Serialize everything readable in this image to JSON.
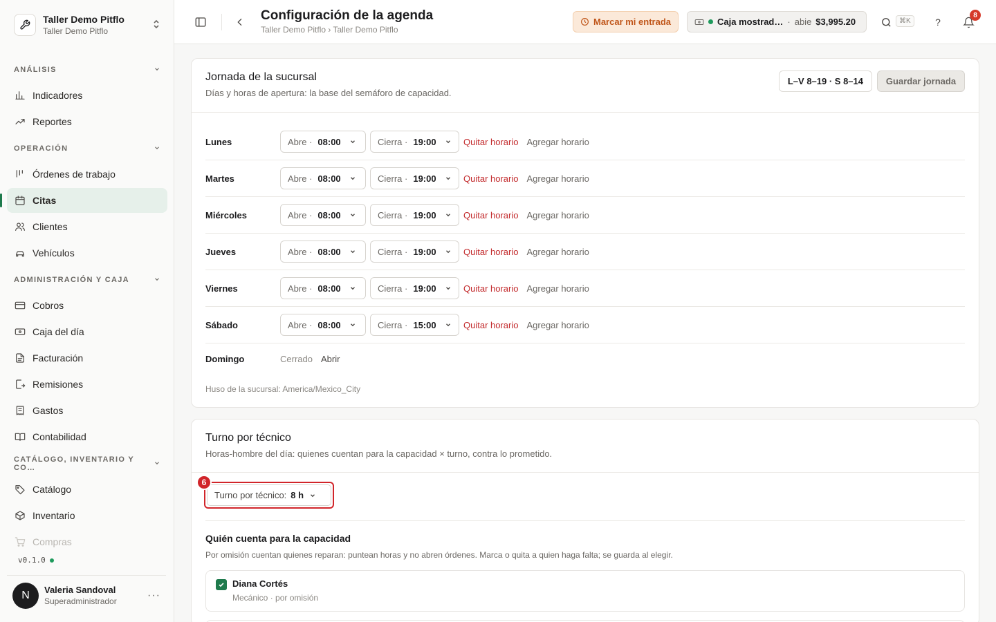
{
  "org": {
    "name": "Taller Demo Pitflo",
    "subtitle": "Taller Demo Pitflo"
  },
  "nav": {
    "sections": [
      {
        "label": "ANÁLISIS",
        "items": [
          {
            "label": "Indicadores",
            "icon": "bar-chart-icon"
          },
          {
            "label": "Reportes",
            "icon": "trend-up-icon"
          }
        ]
      },
      {
        "label": "OPERACIÓN",
        "items": [
          {
            "label": "Órdenes de trabajo",
            "icon": "kanban-icon"
          },
          {
            "label": "Citas",
            "icon": "calendar-icon",
            "active": true
          },
          {
            "label": "Clientes",
            "icon": "users-icon"
          },
          {
            "label": "Vehículos",
            "icon": "car-icon"
          }
        ]
      },
      {
        "label": "ADMINISTRACIÓN Y CAJA",
        "items": [
          {
            "label": "Cobros",
            "icon": "credit-card-icon"
          },
          {
            "label": "Caja del día",
            "icon": "banknote-icon"
          },
          {
            "label": "Facturación",
            "icon": "file-text-icon"
          },
          {
            "label": "Remisiones",
            "icon": "file-export-icon"
          },
          {
            "label": "Gastos",
            "icon": "receipt-icon"
          },
          {
            "label": "Contabilidad",
            "icon": "book-icon"
          }
        ]
      },
      {
        "label": "CATÁLOGO, INVENTARIO Y CO…",
        "items": [
          {
            "label": "Catálogo",
            "icon": "tag-icon"
          },
          {
            "label": "Inventario",
            "icon": "box-icon"
          },
          {
            "label": "Compras",
            "icon": "cart-icon",
            "faded": true
          }
        ]
      }
    ]
  },
  "version": "v0.1.0",
  "user": {
    "initial": "N",
    "name": "Valeria Sandoval",
    "role": "Superadministrador"
  },
  "header": {
    "title": "Configuración de la agenda",
    "breadcrumb": "Taller Demo Pitflo › Taller Demo Pitflo",
    "clock_in": "Marcar mi entrada",
    "caja_name": "Caja mostrad…",
    "caja_sep": "·",
    "caja_state": "abie",
    "caja_amount": "$3,995.20",
    "search_kbd": "⌘K",
    "help": "?",
    "notifications": "8"
  },
  "hours": {
    "title": "Jornada de la sucursal",
    "description": "Días y horas de apertura: la base del semáforo de capacidad.",
    "summary": "L–V 8–19 · S 8–14",
    "save_label": "Guardar jornada",
    "open_prefix": "Abre ·",
    "close_prefix": "Cierra ·",
    "remove_label": "Quitar horario",
    "add_label": "Agregar horario",
    "days": [
      {
        "day": "Lunes",
        "open": "08:00",
        "close": "19:00"
      },
      {
        "day": "Martes",
        "open": "08:00",
        "close": "19:00"
      },
      {
        "day": "Miércoles",
        "open": "08:00",
        "close": "19:00"
      },
      {
        "day": "Jueves",
        "open": "08:00",
        "close": "19:00"
      },
      {
        "day": "Viernes",
        "open": "08:00",
        "close": "19:00"
      },
      {
        "day": "Sábado",
        "open": "08:00",
        "close": "15:00"
      }
    ],
    "sunday": {
      "day": "Domingo",
      "status": "Cerrado",
      "open_label": "Abrir"
    },
    "timezone": "Huso de la sucursal: America/Mexico_City"
  },
  "shift": {
    "title": "Turno por técnico",
    "description": "Horas-hombre del día: quienes cuentan para la capacidad × turno, contra lo prometido.",
    "step": "6",
    "select_label": "Turno por técnico:",
    "select_value": "8 h",
    "capacity_title": "Quién cuenta para la capacidad",
    "capacity_desc": "Por omisión cuentan quienes reparan: puntean horas y no abren órdenes. Marca o quita a quien haga falta; se guarda al elegir.",
    "technicians": [
      {
        "name": "Diana Cortés",
        "role": "Mecánico · por omisión",
        "checked": true
      }
    ]
  }
}
